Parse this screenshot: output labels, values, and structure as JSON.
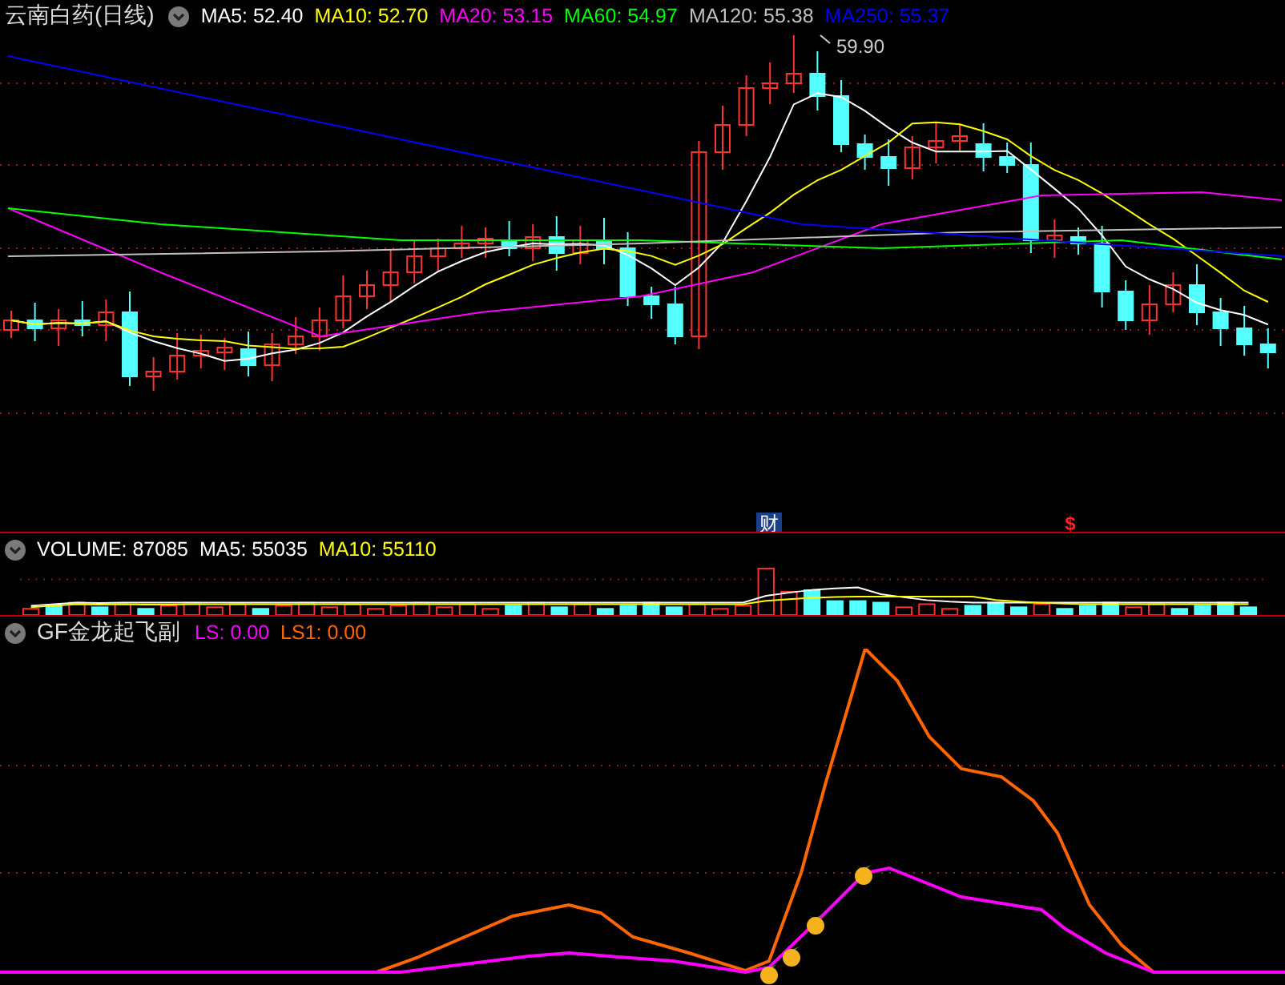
{
  "main_panel": {
    "title": "云南白药(日线)",
    "indicators": [
      {
        "label": "MA5: 52.40",
        "color": "#ffffff"
      },
      {
        "label": "MA10: 52.70",
        "color": "#ffff00"
      },
      {
        "label": "MA20: 53.15",
        "color": "#ff00ff"
      },
      {
        "label": "MA60: 54.97",
        "color": "#00ff00"
      },
      {
        "label": "MA120: 55.38",
        "color": "#c0c0c0"
      },
      {
        "label": "MA250: 55.37",
        "color": "#0000ff"
      }
    ],
    "peak_label": "59.90",
    "event_markers": [
      {
        "kind": "finance",
        "text": "财"
      },
      {
        "kind": "dividend",
        "text": "$"
      }
    ]
  },
  "volume_panel": {
    "indicators": [
      {
        "label": "VOLUME: 87085",
        "color": "#ffffff"
      },
      {
        "label": "MA5: 55035",
        "color": "#ffffff"
      },
      {
        "label": "MA10: 55110",
        "color": "#ffff00"
      }
    ]
  },
  "oscillator_panel": {
    "title": "GF金龙起飞副",
    "indicators": [
      {
        "label": "LS: 0.00",
        "color": "#ff00ff"
      },
      {
        "label": "LS1: 0.00",
        "color": "#ff6600"
      }
    ]
  }
}
